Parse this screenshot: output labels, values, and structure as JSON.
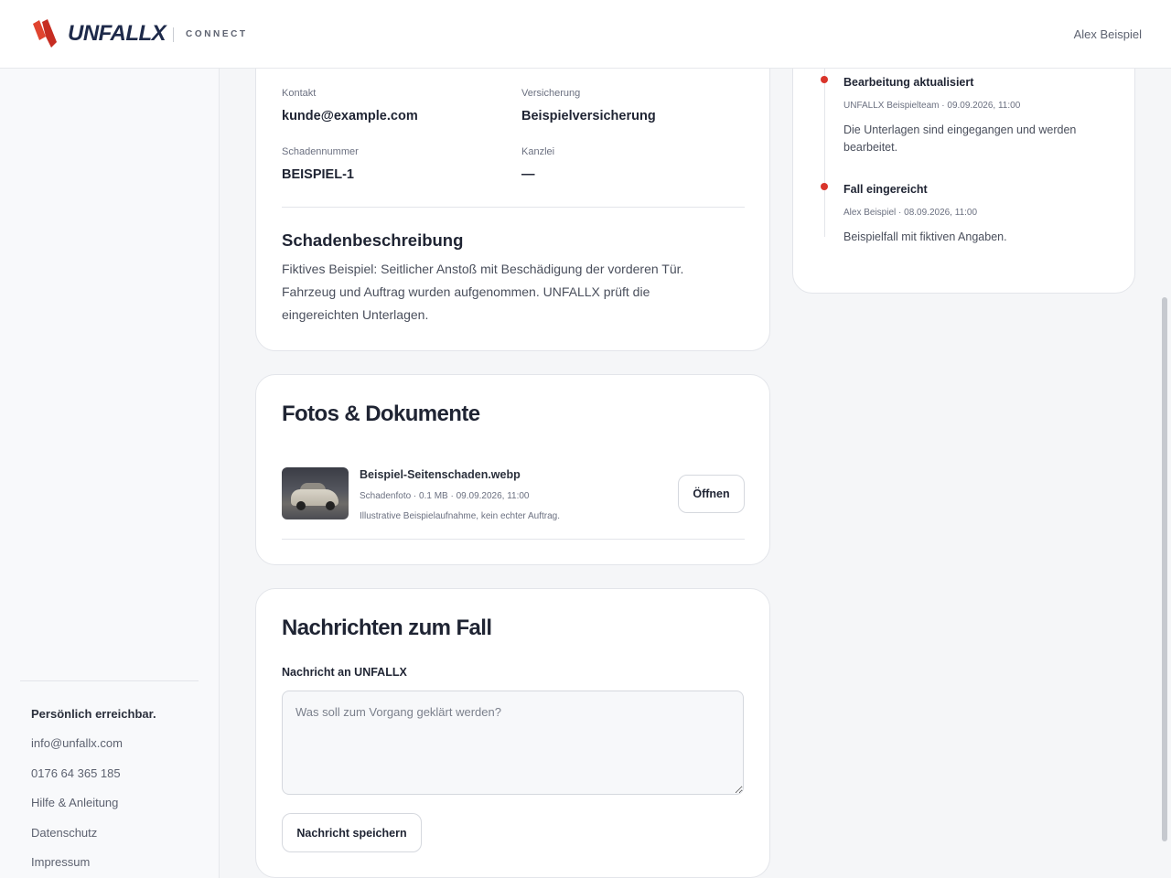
{
  "header": {
    "brand": "UNFALLX",
    "subbrand": "CONNECT",
    "user": "Alex Beispiel"
  },
  "sidebar": {
    "title": "Persönlich erreichbar.",
    "links": [
      "info@unfallx.com",
      "0176 64 365 185",
      "Hilfe & Anleitung",
      "Datenschutz",
      "Impressum"
    ]
  },
  "details": {
    "contact_label": "Kontakt",
    "contact_value": "kunde@example.com",
    "insurance_label": "Versicherung",
    "insurance_value": "Beispielversicherung",
    "claim_label": "Schadennummer",
    "claim_value": "BEISPIEL-1",
    "firm_label": "Kanzlei",
    "firm_value": "—",
    "description_title": "Schadenbeschreibung",
    "description_lines": [
      "Fiktives Beispiel: Seitlicher Anstoß mit Beschädigung der vorderen Tür.",
      "Fahrzeug und Auftrag wurden aufgenommen. UNFALLX prüft die",
      "eingereichten Unterlagen."
    ]
  },
  "documents": {
    "title": "Fotos & Dokumente",
    "file": {
      "name": "Beispiel-Seitenschaden.webp",
      "meta": "Schadenfoto · 0.1 MB · 09.09.2026, 11:00",
      "note": "Illustrative Beispielaufnahme, kein echter Auftrag.",
      "open_label": "Öffnen"
    }
  },
  "messages": {
    "title": "Nachrichten zum Fall",
    "field_label": "Nachricht an UNFALLX",
    "placeholder": "Was soll zum Vorgang geklärt werden?",
    "save_label": "Nachricht speichern"
  },
  "timeline": [
    {
      "title": "Bearbeitung aktualisiert",
      "meta": "UNFALLX Beispielteam · 09.09.2026, 11:00",
      "text": "Die Unterlagen sind eingegangen und werden bearbeitet."
    },
    {
      "title": "Fall eingereicht",
      "meta": "Alex Beispiel · 08.09.2026, 11:00",
      "text": "Beispielfall mit fiktiven Angaben."
    }
  ],
  "colors": {
    "accent": "#d9352b",
    "brand_text": "#1e2a4a",
    "background": "#f5f6f8"
  }
}
